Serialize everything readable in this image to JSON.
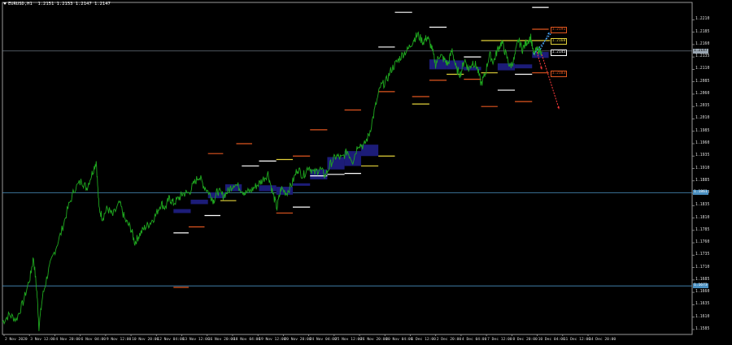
{
  "window": {
    "symbol": "EURUSD,H1",
    "ohlc": "1.2151 1.2153 1.2147 1.2147"
  },
  "colors": {
    "background": "#000000",
    "price": "#1fa81f",
    "axis": "#9a9a9a",
    "hline": "#4a8fc0",
    "current": "#7c8a99",
    "zone": "#1c1c78",
    "orange": "#e0561f",
    "white": "#ffffff",
    "yellow": "#e3d23a",
    "up_arrow": "#4aa8ff",
    "down_arrow": "#ff3b3b"
  },
  "price_axis": {
    "min": 1.1575,
    "max": 1.2245,
    "ticks": [
      "1.2210",
      "1.2185",
      "1.2160",
      "1.2135",
      "1.2110",
      "1.2085",
      "1.2060",
      "1.2035",
      "1.2010",
      "1.1985",
      "1.1960",
      "1.1935",
      "1.1910",
      "1.1885",
      "1.1860",
      "1.1835",
      "1.1810",
      "1.1785",
      "1.1760",
      "1.1735",
      "1.1710",
      "1.1685",
      "1.1660",
      "1.1635",
      "1.1610",
      "1.1585"
    ],
    "current": {
      "value": 1.2147,
      "label": "1.2147"
    },
    "levels": [
      {
        "value": 1.1861,
        "label": "1.1861"
      },
      {
        "value": 1.1673,
        "label": "1.1673"
      }
    ]
  },
  "time_axis": {
    "labels": [
      "2 Nov 2020",
      "3 Nov 12:00",
      "4 Nov 20:00",
      "6 Nov 04:00",
      "9 Nov 12:00",
      "10 Nov 20:00",
      "12 Nov 04:00",
      "13 Nov 12:00",
      "16 Nov 20:00",
      "18 Nov 04:00",
      "19 Nov 12:00",
      "20 Nov 20:00",
      "24 Nov 04:00",
      "25 Nov 12:00",
      "26 Nov 20:00",
      "30 Nov 04:00",
      "1 Dec 12:00",
      "2 Dec 20:00",
      "4 Dec 04:00",
      "7 Dec 12:00",
      "8 Dec 20:00",
      "10 Dec 04:00",
      "11 Dec 12:00",
      "14 Dec 20:00"
    ]
  },
  "price_boxes": [
    {
      "label": "1.2191",
      "value": 1.2191,
      "color": "orange"
    },
    {
      "label": "1.2168",
      "value": 1.2168,
      "color": "yellow"
    },
    {
      "label": "1.2145",
      "value": 1.2145,
      "color": "white"
    },
    {
      "label": "1.2103",
      "value": 1.2103,
      "color": "orange"
    }
  ],
  "zones": [
    {
      "t0": 0.248,
      "t1": 0.273,
      "p0": 1.1828,
      "p1": 1.182
    },
    {
      "t0": 0.273,
      "t1": 0.298,
      "p0": 1.1847,
      "p1": 1.1838
    },
    {
      "t0": 0.298,
      "t1": 0.323,
      "p0": 1.1862,
      "p1": 1.185
    },
    {
      "t0": 0.323,
      "t1": 0.347,
      "p0": 1.1878,
      "p1": 1.1864
    },
    {
      "t0": 0.372,
      "t1": 0.397,
      "p0": 1.1876,
      "p1": 1.1864
    },
    {
      "t0": 0.397,
      "t1": 0.421,
      "p0": 1.1873,
      "p1": 1.1857
    },
    {
      "t0": 0.421,
      "t1": 0.446,
      "p0": 1.188,
      "p1": 1.1875
    },
    {
      "t0": 0.446,
      "t1": 0.471,
      "p0": 1.1908,
      "p1": 1.1888
    },
    {
      "t0": 0.471,
      "t1": 0.496,
      "p0": 1.1933,
      "p1": 1.1908
    },
    {
      "t0": 0.496,
      "t1": 0.52,
      "p0": 1.1945,
      "p1": 1.1915
    },
    {
      "t0": 0.52,
      "t1": 0.545,
      "p0": 1.1958,
      "p1": 1.1935
    },
    {
      "t0": 0.619,
      "t1": 0.644,
      "p0": 1.213,
      "p1": 1.211
    },
    {
      "t0": 0.644,
      "t1": 0.669,
      "p0": 1.2128,
      "p1": 1.211
    },
    {
      "t0": 0.669,
      "t1": 0.694,
      "p0": 1.2115,
      "p1": 1.2108
    },
    {
      "t0": 0.718,
      "t1": 0.743,
      "p0": 1.2122,
      "p1": 1.2108
    },
    {
      "t0": 0.743,
      "t1": 0.768,
      "p0": 1.212,
      "p1": 1.2112
    },
    {
      "t0": 0.768,
      "t1": 0.792,
      "p0": 1.2145,
      "p1": 1.2133
    }
  ],
  "markers": [
    {
      "color": "white",
      "t0": 0.248,
      "t1": 0.27,
      "p": 1.178
    },
    {
      "color": "orange",
      "t0": 0.27,
      "t1": 0.293,
      "p": 1.1792
    },
    {
      "color": "white",
      "t0": 0.293,
      "t1": 0.316,
      "p": 1.1815
    },
    {
      "color": "yellow",
      "t0": 0.316,
      "t1": 0.339,
      "p": 1.1845
    },
    {
      "color": "orange",
      "t0": 0.339,
      "t1": 0.362,
      "p": 1.196
    },
    {
      "color": "orange",
      "t0": 0.298,
      "t1": 0.32,
      "p": 1.194
    },
    {
      "color": "white",
      "t0": 0.347,
      "t1": 0.372,
      "p": 1.1915
    },
    {
      "color": "white",
      "t0": 0.372,
      "t1": 0.397,
      "p": 1.1925
    },
    {
      "color": "yellow",
      "t0": 0.397,
      "t1": 0.421,
      "p": 1.1928
    },
    {
      "color": "orange",
      "t0": 0.421,
      "t1": 0.446,
      "p": 1.1935
    },
    {
      "color": "orange",
      "t0": 0.397,
      "t1": 0.421,
      "p": 1.182
    },
    {
      "color": "white",
      "t0": 0.421,
      "t1": 0.446,
      "p": 1.1832
    },
    {
      "color": "white",
      "t0": 0.446,
      "t1": 0.471,
      "p": 1.1895
    },
    {
      "color": "orange",
      "t0": 0.446,
      "t1": 0.471,
      "p": 1.1988
    },
    {
      "color": "white",
      "t0": 0.471,
      "t1": 0.496,
      "p": 1.1898
    },
    {
      "color": "orange",
      "t0": 0.496,
      "t1": 0.52,
      "p": 1.2028
    },
    {
      "color": "white",
      "t0": 0.496,
      "t1": 0.52,
      "p": 1.19
    },
    {
      "color": "yellow",
      "t0": 0.52,
      "t1": 0.545,
      "p": 1.1915
    },
    {
      "color": "yellow",
      "t0": 0.545,
      "t1": 0.569,
      "p": 1.1935
    },
    {
      "color": "orange",
      "t0": 0.545,
      "t1": 0.569,
      "p": 1.2065
    },
    {
      "color": "white",
      "t0": 0.545,
      "t1": 0.569,
      "p": 1.2155
    },
    {
      "color": "white",
      "t0": 0.569,
      "t1": 0.594,
      "p": 1.2225
    },
    {
      "color": "orange",
      "t0": 0.594,
      "t1": 0.619,
      "p": 1.2055
    },
    {
      "color": "yellow",
      "t0": 0.594,
      "t1": 0.619,
      "p": 1.204
    },
    {
      "color": "white",
      "t0": 0.619,
      "t1": 0.644,
      "p": 1.2195
    },
    {
      "color": "orange",
      "t0": 0.619,
      "t1": 0.644,
      "p": 1.2088
    },
    {
      "color": "yellow",
      "t0": 0.644,
      "t1": 0.669,
      "p": 1.21
    },
    {
      "color": "white",
      "t0": 0.669,
      "t1": 0.694,
      "p": 1.2135
    },
    {
      "color": "orange",
      "t0": 0.669,
      "t1": 0.694,
      "p": 1.209
    },
    {
      "color": "yellow",
      "t0": 0.694,
      "t1": 0.718,
      "p": 1.2103
    },
    {
      "color": "orange",
      "t0": 0.694,
      "t1": 0.718,
      "p": 1.2035
    },
    {
      "color": "white",
      "t0": 0.718,
      "t1": 0.743,
      "p": 1.2068
    },
    {
      "color": "white",
      "t0": 0.743,
      "t1": 0.768,
      "p": 1.21
    },
    {
      "color": "orange",
      "t0": 0.743,
      "t1": 0.768,
      "p": 1.2045
    },
    {
      "color": "yellow",
      "t0": 0.694,
      "t1": 0.794,
      "p": 1.2168
    },
    {
      "color": "white",
      "t0": 0.768,
      "t1": 0.792,
      "p": 1.2235
    },
    {
      "color": "orange",
      "t0": 0.248,
      "t1": 0.27,
      "p": 1.167
    },
    {
      "color": "orange",
      "t0": 0.768,
      "t1": 0.792,
      "p": 1.2191
    },
    {
      "color": "orange",
      "t0": 0.768,
      "t1": 0.792,
      "p": 1.2103
    }
  ],
  "projections": [
    {
      "color": "up_arrow",
      "t0": 0.77,
      "p0": 1.214,
      "t1": 0.8,
      "p1": 1.219
    },
    {
      "color": "up_arrow",
      "t0": 0.78,
      "p0": 1.215,
      "t1": 0.793,
      "p1": 1.2185
    },
    {
      "color": "down_arrow",
      "t0": 0.782,
      "p0": 1.214,
      "t1": 0.807,
      "p1": 1.203
    },
    {
      "color": "down_arrow",
      "t0": 0.775,
      "p0": 1.2145,
      "t1": 0.782,
      "p1": 1.211
    }
  ],
  "price_path": [
    [
      0.0,
      1.16
    ],
    [
      0.01,
      1.1615
    ],
    [
      0.02,
      1.1605
    ],
    [
      0.03,
      1.164
    ],
    [
      0.04,
      1.169
    ],
    [
      0.045,
      1.173
    ],
    [
      0.05,
      1.166
    ],
    [
      0.053,
      1.159
    ],
    [
      0.058,
      1.165
    ],
    [
      0.066,
      1.17
    ],
    [
      0.075,
      1.174
    ],
    [
      0.085,
      1.178
    ],
    [
      0.095,
      1.183
    ],
    [
      0.105,
      1.187
    ],
    [
      0.115,
      1.1885
    ],
    [
      0.122,
      1.187
    ],
    [
      0.13,
      1.19
    ],
    [
      0.136,
      1.1925
    ],
    [
      0.14,
      1.183
    ],
    [
      0.145,
      1.181
    ],
    [
      0.152,
      1.183
    ],
    [
      0.16,
      1.1815
    ],
    [
      0.17,
      1.184
    ],
    [
      0.178,
      1.1805
    ],
    [
      0.186,
      1.179
    ],
    [
      0.192,
      1.176
    ],
    [
      0.198,
      1.1775
    ],
    [
      0.206,
      1.179
    ],
    [
      0.214,
      1.18
    ],
    [
      0.222,
      1.1815
    ],
    [
      0.23,
      1.184
    ],
    [
      0.236,
      1.183
    ],
    [
      0.242,
      1.185
    ],
    [
      0.248,
      1.184
    ],
    [
      0.256,
      1.185
    ],
    [
      0.262,
      1.186
    ],
    [
      0.27,
      1.186
    ],
    [
      0.278,
      1.188
    ],
    [
      0.285,
      1.1895
    ],
    [
      0.292,
      1.1875
    ],
    [
      0.3,
      1.186
    ],
    [
      0.306,
      1.1845
    ],
    [
      0.312,
      1.1865
    ],
    [
      0.32,
      1.1855
    ],
    [
      0.328,
      1.1865
    ],
    [
      0.336,
      1.188
    ],
    [
      0.345,
      1.187
    ],
    [
      0.352,
      1.186
    ],
    [
      0.36,
      1.1865
    ],
    [
      0.368,
      1.1875
    ],
    [
      0.376,
      1.1885
    ],
    [
      0.385,
      1.19
    ],
    [
      0.392,
      1.186
    ],
    [
      0.398,
      1.183
    ],
    [
      0.404,
      1.187
    ],
    [
      0.412,
      1.186
    ],
    [
      0.42,
      1.188
    ],
    [
      0.428,
      1.191
    ],
    [
      0.436,
      1.1895
    ],
    [
      0.444,
      1.1915
    ],
    [
      0.452,
      1.19
    ],
    [
      0.46,
      1.191
    ],
    [
      0.468,
      1.1895
    ],
    [
      0.476,
      1.192
    ],
    [
      0.484,
      1.1935
    ],
    [
      0.492,
      1.193
    ],
    [
      0.5,
      1.1945
    ],
    [
      0.508,
      1.1925
    ],
    [
      0.516,
      1.196
    ],
    [
      0.524,
      1.1955
    ],
    [
      0.532,
      1.198
    ],
    [
      0.54,
      1.203
    ],
    [
      0.548,
      1.2075
    ],
    [
      0.556,
      1.2085
    ],
    [
      0.564,
      1.211
    ],
    [
      0.572,
      1.2125
    ],
    [
      0.58,
      1.214
    ],
    [
      0.588,
      1.215
    ],
    [
      0.596,
      1.217
    ],
    [
      0.602,
      1.218
    ],
    [
      0.61,
      1.2165
    ],
    [
      0.616,
      1.2175
    ],
    [
      0.622,
      1.2155
    ],
    [
      0.628,
      1.212
    ],
    [
      0.634,
      1.214
    ],
    [
      0.64,
      1.213
    ],
    [
      0.646,
      1.212
    ],
    [
      0.652,
      1.215
    ],
    [
      0.658,
      1.211
    ],
    [
      0.664,
      1.21
    ],
    [
      0.67,
      1.213
    ],
    [
      0.676,
      1.211
    ],
    [
      0.682,
      1.2125
    ],
    [
      0.688,
      1.2115
    ],
    [
      0.694,
      1.208
    ],
    [
      0.7,
      1.21
    ],
    [
      0.706,
      1.214
    ],
    [
      0.712,
      1.2125
    ],
    [
      0.718,
      1.215
    ],
    [
      0.724,
      1.2165
    ],
    [
      0.73,
      1.214
    ],
    [
      0.736,
      1.2115
    ],
    [
      0.742,
      1.213
    ],
    [
      0.748,
      1.217
    ],
    [
      0.754,
      1.215
    ],
    [
      0.76,
      1.2165
    ],
    [
      0.766,
      1.2175
    ],
    [
      0.77,
      1.214
    ],
    [
      0.776,
      1.215
    ],
    [
      0.782,
      1.2147
    ]
  ]
}
